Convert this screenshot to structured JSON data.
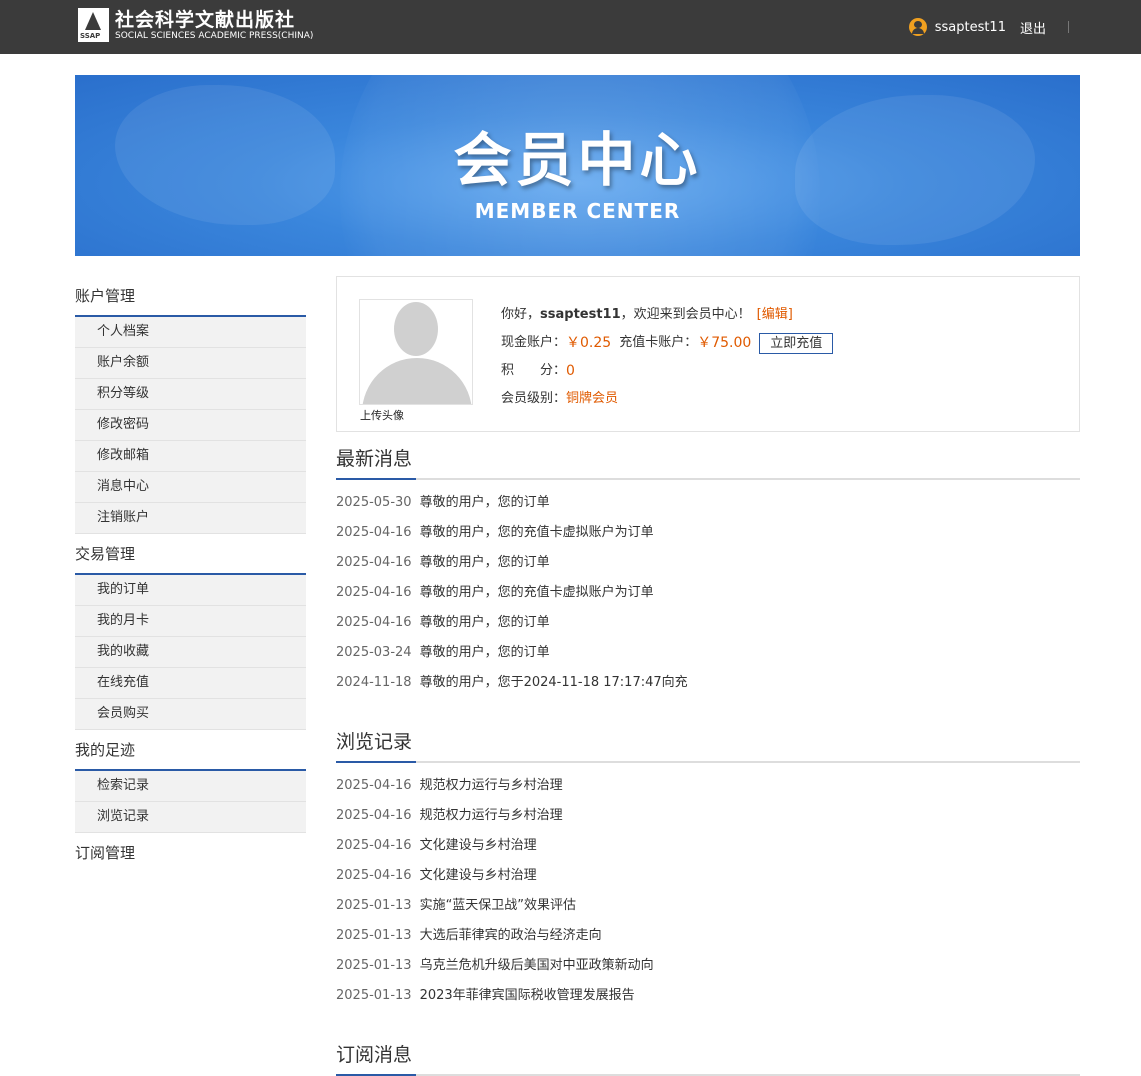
{
  "header": {
    "logo_cn": "社会科学文献出版社",
    "logo_en": "SOCIAL SCIENCES ACADEMIC PRESS(CHINA)",
    "logo_mark": "SSAP",
    "username": "ssaptest11",
    "logout": "退出"
  },
  "banner": {
    "title": "会员中心",
    "subtitle": "MEMBER CENTER"
  },
  "sidebar": {
    "groups": [
      {
        "title": "账户管理",
        "items": [
          "个人档案",
          "账户余额",
          "积分等级",
          "修改密码",
          "修改邮箱",
          "消息中心",
          "注销账户"
        ]
      },
      {
        "title": "交易管理",
        "items": [
          "我的订单",
          "我的月卡",
          "我的收藏",
          "在线充值",
          "会员购买"
        ]
      },
      {
        "title": "我的足迹",
        "items": [
          "检索记录",
          "浏览记录"
        ]
      },
      {
        "title": "订阅管理",
        "items": []
      }
    ]
  },
  "profile": {
    "avatar_label": "上传头像",
    "greeting_prefix": "你好，",
    "username": "ssaptest11",
    "greeting_suffix": "，欢迎来到会员中心！",
    "edit": "[编辑]",
    "cash_label": "现金账户：",
    "cash_value": "￥0.25",
    "card_label": "充值卡账户：",
    "card_value": "￥75.00",
    "recharge_button": "立即充值",
    "points_label": "积　　分：",
    "points_value": "0",
    "level_label": "会员级别：",
    "level_value": "铜牌会员"
  },
  "messages": {
    "title": "最新消息",
    "items": [
      {
        "date": "2025-05-30",
        "text": "尊敬的用户，您的订单"
      },
      {
        "date": "2025-04-16",
        "text": "尊敬的用户，您的充值卡虚拟账户为订单"
      },
      {
        "date": "2025-04-16",
        "text": "尊敬的用户，您的订单"
      },
      {
        "date": "2025-04-16",
        "text": "尊敬的用户，您的充值卡虚拟账户为订单"
      },
      {
        "date": "2025-04-16",
        "text": "尊敬的用户，您的订单"
      },
      {
        "date": "2025-03-24",
        "text": "尊敬的用户，您的订单"
      },
      {
        "date": "2024-11-18",
        "text": "尊敬的用户，您于2024-11-18 17:17:47向充"
      }
    ]
  },
  "history": {
    "title": "浏览记录",
    "items": [
      {
        "date": "2025-04-16",
        "text": "规范权力运行与乡村治理"
      },
      {
        "date": "2025-04-16",
        "text": "规范权力运行与乡村治理"
      },
      {
        "date": "2025-04-16",
        "text": "文化建设与乡村治理"
      },
      {
        "date": "2025-04-16",
        "text": "文化建设与乡村治理"
      },
      {
        "date": "2025-01-13",
        "text": "实施“蓝天保卫战”效果评估"
      },
      {
        "date": "2025-01-13",
        "text": "大选后菲律宾的政治与经济走向"
      },
      {
        "date": "2025-01-13",
        "text": "乌克兰危机升级后美国对中亚政策新动向"
      },
      {
        "date": "2025-01-13",
        "text": "2023年菲律宾国际税收管理发展报告"
      }
    ]
  },
  "subscriptions": {
    "title": "订阅消息"
  }
}
